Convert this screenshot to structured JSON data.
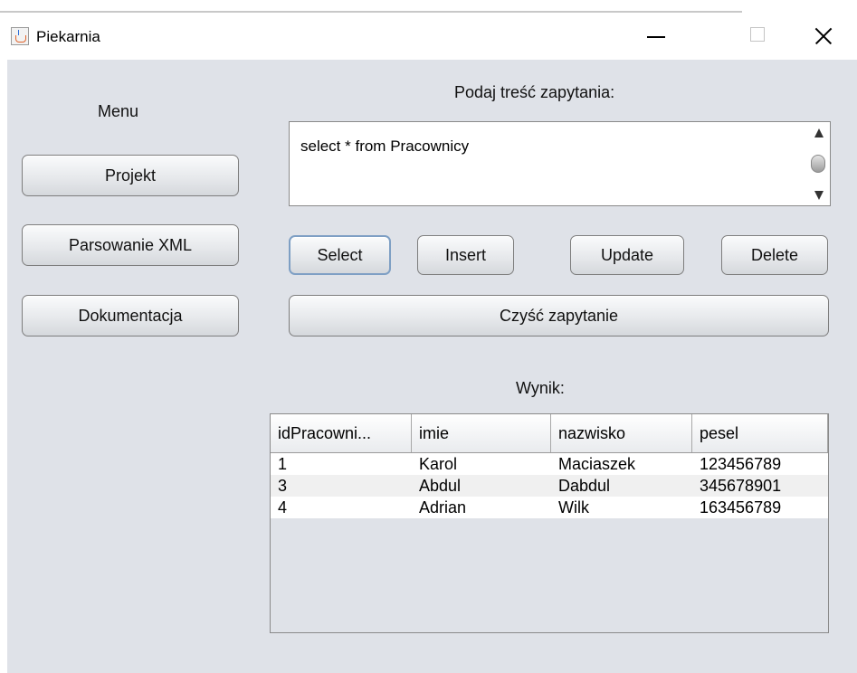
{
  "window": {
    "title": "Piekarnia"
  },
  "sidebar": {
    "heading": "Menu",
    "buttons": [
      "Projekt",
      "Parsowanie XML",
      "Dokumentacja"
    ]
  },
  "query": {
    "label": "Podaj treść zapytania:",
    "value": "select * from Pracownicy"
  },
  "actions": {
    "select": "Select",
    "insert": "Insert",
    "update": "Update",
    "delete": "Delete",
    "clear": "Czyść zapytanie"
  },
  "result": {
    "label": "Wynik:",
    "columns": [
      "idPracowni...",
      "imie",
      "nazwisko",
      "pesel"
    ],
    "rows": [
      [
        "1",
        "Karol",
        "Maciaszek",
        "123456789"
      ],
      [
        "3",
        "Abdul",
        "Dabdul",
        "345678901"
      ],
      [
        "4",
        "Adrian",
        "Wilk",
        "163456789"
      ]
    ]
  }
}
